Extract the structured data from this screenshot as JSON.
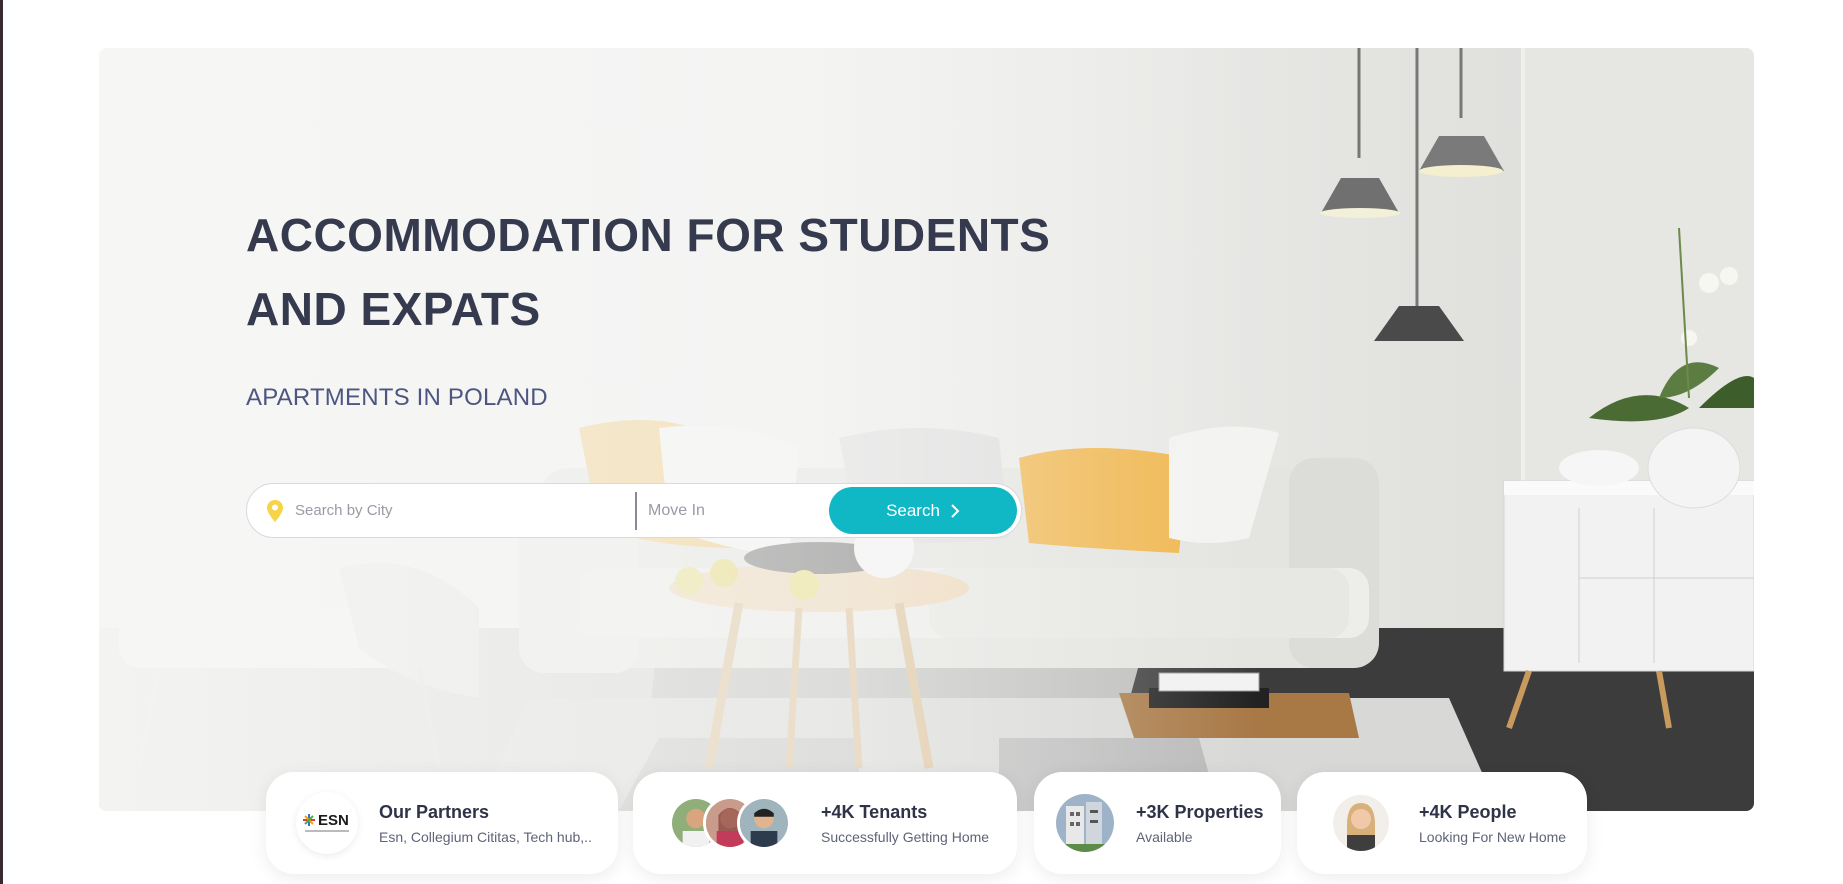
{
  "hero": {
    "headline_line1": "ACCOMMODATION FOR STUDENTS",
    "headline_line2": "AND EXPATS",
    "subtitle": "APARTMENTS IN POLAND"
  },
  "search": {
    "city_placeholder": "Search by City",
    "movein_placeholder": "Move In",
    "button_label": "Search"
  },
  "stats": [
    {
      "title": "Our Partners",
      "subtitle": "Esn, Collegium Cititas, Tech hub,..",
      "logo_text": "ESN"
    },
    {
      "title": "+4K Tenants",
      "subtitle": "Successfully Getting Home"
    },
    {
      "title": "+3K Properties",
      "subtitle": "Available"
    },
    {
      "title": "+4K People",
      "subtitle": "Looking For New Home"
    }
  ],
  "colors": {
    "accent": "#0fb8c4",
    "heading": "#363a4e",
    "subheading": "#4d5680",
    "pin": "#f5d447"
  },
  "icons": {
    "location": "location-pin-icon",
    "chevron": "chevron-right-icon"
  }
}
